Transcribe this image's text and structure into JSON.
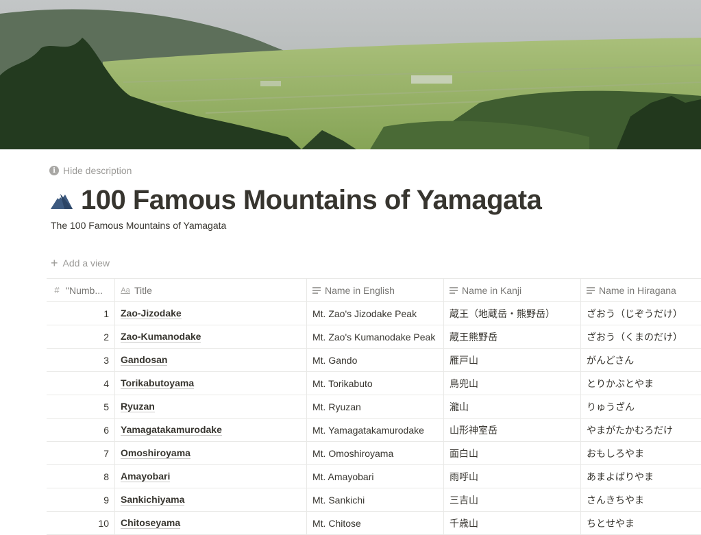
{
  "page": {
    "hide_description": "Hide description",
    "icon": "mountain-emoji",
    "title": "100 Famous Mountains of Yamagata",
    "description": "The 100 Famous Mountains of Yamagata",
    "add_view": "Add a view"
  },
  "table": {
    "columns": [
      {
        "label": "\"Numb...",
        "icon": "number-icon"
      },
      {
        "label": "Title",
        "icon": "title-aa-icon"
      },
      {
        "label": "Name in English",
        "icon": "text-lines-icon"
      },
      {
        "label": "Name in Kanji",
        "icon": "text-lines-icon"
      },
      {
        "label": "Name in Hiragana",
        "icon": "text-lines-icon"
      }
    ],
    "rows": [
      {
        "num": "1",
        "title": "Zao-Jizodake",
        "english": "Mt. Zao's Jizodake Peak",
        "kanji": "蔵王（地蔵岳・熊野岳）",
        "hiragana": "ざおう（じぞうだけ）"
      },
      {
        "num": "2",
        "title": "Zao-Kumanodake",
        "english": "Mt. Zao's Kumanodake Peak",
        "kanji": "蔵王熊野岳",
        "hiragana": "ざおう（くまのだけ）"
      },
      {
        "num": "3",
        "title": "Gandosan",
        "english": "Mt. Gando",
        "kanji": "雁戸山",
        "hiragana": "がんどさん"
      },
      {
        "num": "4",
        "title": "Torikabutoyama",
        "english": "Mt. Torikabuto",
        "kanji": "鳥兜山",
        "hiragana": "とりかぶとやま"
      },
      {
        "num": "5",
        "title": "Ryuzan",
        "english": "Mt. Ryuzan",
        "kanji": "瀧山",
        "hiragana": "りゅうざん"
      },
      {
        "num": "6",
        "title": "Yamagatakamurodake",
        "english": "Mt. Yamagatakamurodake",
        "kanji": "山形神室岳",
        "hiragana": "やまがたかむろだけ"
      },
      {
        "num": "7",
        "title": "Omoshiroyama",
        "english": "Mt. Omoshiroyama",
        "kanji": "面白山",
        "hiragana": "おもしろやま"
      },
      {
        "num": "8",
        "title": "Amayobari",
        "english": "Mt. Amayobari",
        "kanji": "雨呼山",
        "hiragana": "あまよばりやま"
      },
      {
        "num": "9",
        "title": "Sankichiyama",
        "english": "Mt. Sankichi",
        "kanji": "三吉山",
        "hiragana": "さんきちやま"
      },
      {
        "num": "10",
        "title": "Chitoseyama",
        "english": "Mt. Chitose",
        "kanji": "千歳山",
        "hiragana": "ちとせやま"
      }
    ]
  }
}
